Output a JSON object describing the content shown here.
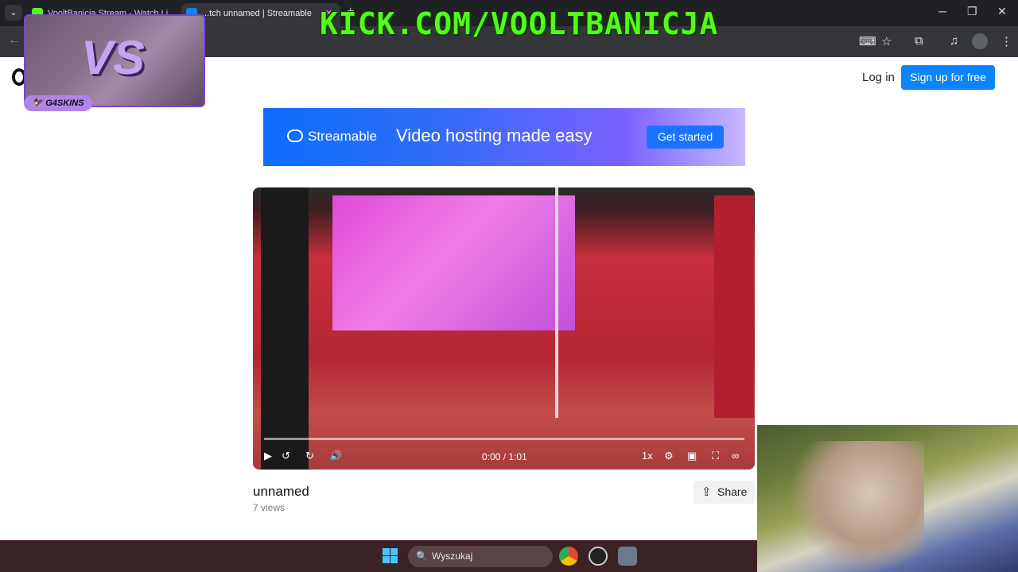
{
  "browser": {
    "tabs": [
      {
        "title": "VooltBanicja Stream - Watch Li...",
        "favicon_color": "#53fc18"
      },
      {
        "title": "...tch unnamed | Streamable",
        "favicon_color": "#0a84ff"
      }
    ],
    "new_tab_label": "+",
    "window_controls": [
      "minimize",
      "restore",
      "close"
    ]
  },
  "overlays": {
    "kick_text": "KICK.COM/VOOLTBANICJA",
    "g4skins_vs": "VS",
    "g4skins_label": "G4SKINS"
  },
  "header": {
    "login_label": "Log in",
    "signup_label": "Sign up for free"
  },
  "banner": {
    "brand": "Streamable",
    "tagline": "Video hosting made easy",
    "cta_label": "Get started"
  },
  "player": {
    "time_label": "0:00 / 1:01",
    "speed_label": "1x",
    "progress": 0.0
  },
  "video": {
    "title": "unnamed",
    "views": "7 views",
    "share_label": "Share"
  },
  "taskbar": {
    "search_placeholder": "Wyszukaj"
  }
}
